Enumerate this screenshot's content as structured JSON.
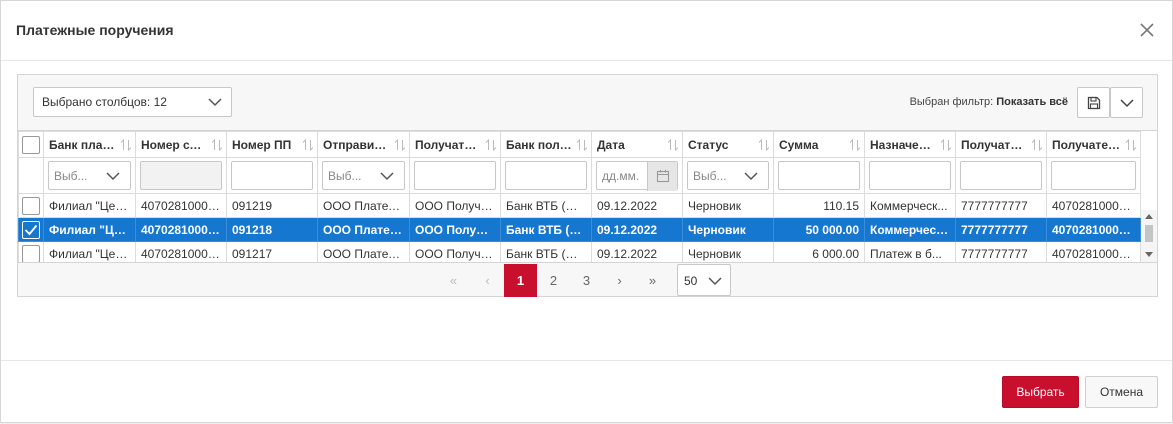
{
  "dialog": {
    "title": "Платежные поручения",
    "close_icon": "close-icon"
  },
  "toolbar": {
    "columns_selected": "Выбрано столбцов: 12",
    "filter_label": "Выбран фильтр:",
    "filter_value": "Показать всё",
    "save_icon": "floppy-disk-icon",
    "menu_icon": "chevron-down-icon"
  },
  "table": {
    "columns": [
      "Банк плательщика",
      "Номер счета",
      "Номер ПП",
      "Отправитель",
      "Получатель",
      "Банк получателя",
      "Дата",
      "Статус",
      "Сумма",
      "Назначение",
      "Получатель ИНН",
      "Получатель счет"
    ],
    "filters": {
      "bank": "Выб...",
      "sender": "Выб...",
      "date_placeholder": "дд.мм.",
      "status": "Выб..."
    },
    "rows": [
      {
        "selected": false,
        "cells": [
          "Филиал \"Цен...",
          "40702810000...",
          "091219",
          "ООО Платель...",
          "ООО Получа...",
          "Банк ВТБ (ПА...",
          "09.12.2022",
          "Черновик",
          "110.15",
          "Коммерческ...",
          "7777777777",
          "40702810000..."
        ]
      },
      {
        "selected": true,
        "cells": [
          "Филиал \"Цен...",
          "40702810000...",
          "091218",
          "ООО Платель...",
          "ООО Получа...",
          "Банк ВТБ (ПА...",
          "09.12.2022",
          "Черновик",
          "50 000.00",
          "Коммерческ...",
          "7777777777",
          "40702810000..."
        ]
      },
      {
        "selected": false,
        "cells": [
          "Филиал \"Цен...",
          "40702810000...",
          "091217",
          "ООО Платель...",
          "ООО Получа...",
          "Банк ВТБ (ПА...",
          "09.12.2022",
          "Черновик",
          "6 000.00",
          "Платеж в б...",
          "7777777777",
          "40702810000..."
        ]
      }
    ]
  },
  "pager": {
    "first": "«",
    "prev": "‹",
    "pages": [
      "1",
      "2",
      "3"
    ],
    "current": "1",
    "next": "›",
    "last": "»",
    "page_size": "50"
  },
  "footer": {
    "select_label": "Выбрать",
    "cancel_label": "Отмена"
  }
}
